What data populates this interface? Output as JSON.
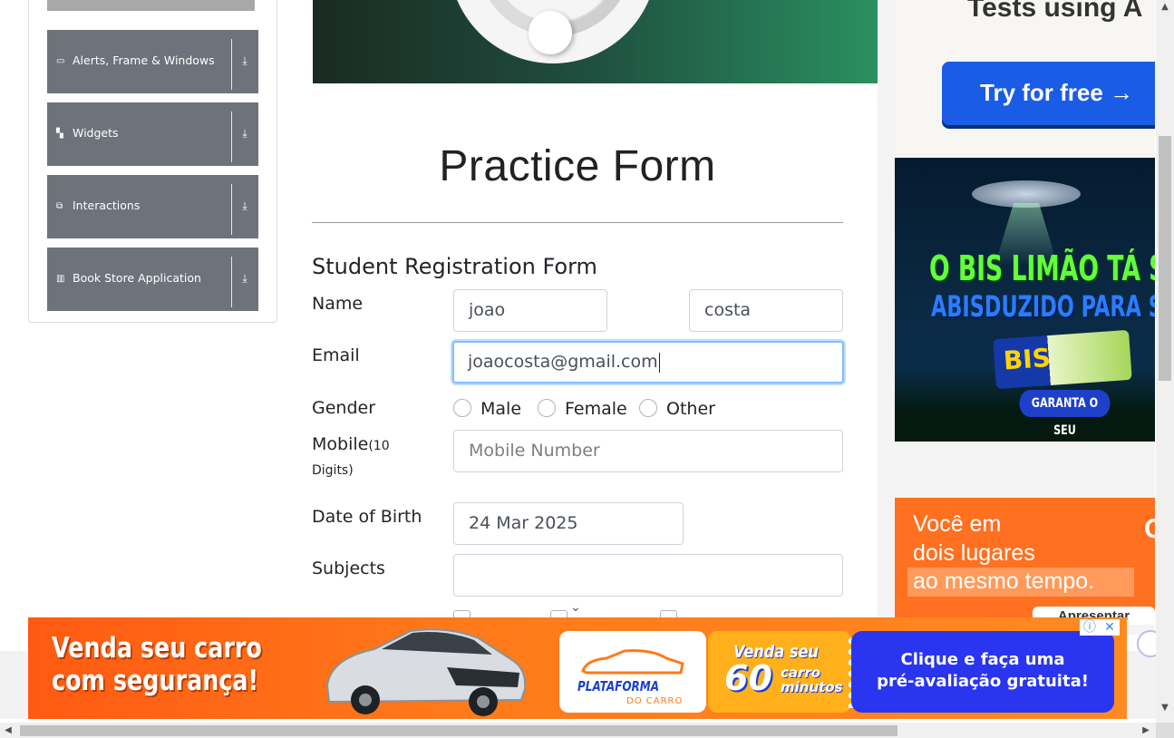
{
  "sidebar": {
    "groups": [
      {
        "label": "Alerts, Frame & Windows",
        "icon": "window-icon"
      },
      {
        "label": "Widgets",
        "icon": "widgets-icon"
      },
      {
        "label": "Interactions",
        "icon": "interactions-icon"
      },
      {
        "label": "Book Store Application",
        "icon": "book-icon"
      }
    ]
  },
  "main": {
    "title": "Practice Form",
    "form_heading": "Student Registration Form",
    "labels": {
      "name": "Name",
      "email": "Email",
      "gender": "Gender",
      "mobile": "Mobile",
      "mobile_hint": "(10 Digits)",
      "mobile_hint_a": "(10",
      "mobile_hint_b": "Digits)",
      "dob": "Date of Birth",
      "subjects": "Subjects"
    },
    "fields": {
      "first_name": "joao",
      "last_name": "costa",
      "email": "joaocosta@gmail.com",
      "mobile_placeholder": "Mobile Number",
      "dob": "24 Mar 2025",
      "subjects": ""
    },
    "gender_options": [
      "Male",
      "Female",
      "Other"
    ]
  },
  "ads": {
    "ad1": {
      "headline": "Tests using A",
      "button": "Try for free →"
    },
    "ad2": {
      "line1": "O BIS LIMÃO TÁ SEN",
      "line2": "ABISDUZIDO PARA SEM",
      "brand": "BIS",
      "cta": "GARANTA O SEU"
    },
    "ad3": {
      "line1": "Você em",
      "line2": "dois lugares",
      "line3": "ao mesmo tempo.",
      "button": "Apresentar",
      "cut": "C"
    },
    "bottom": {
      "headline_1": "Venda seu carro",
      "headline_2": "com segurança!",
      "logo_1": "PLATAFORMA",
      "logo_2": "DO CARRO",
      "promo_1": "Venda seu",
      "promo_num": "60",
      "promo_2a": "carro",
      "promo_2b": "minutos",
      "cta_1": "Clique e faça uma",
      "cta_2": "pré-avaliação gratuita!",
      "info": "ⓘ",
      "close": "✕"
    }
  },
  "colors": {
    "sidebar_group_bg": "#6c737a",
    "focus_border": "#80bdff",
    "bottom_ad": "#ff7a1a",
    "cta_blue": "#2a35f0"
  }
}
